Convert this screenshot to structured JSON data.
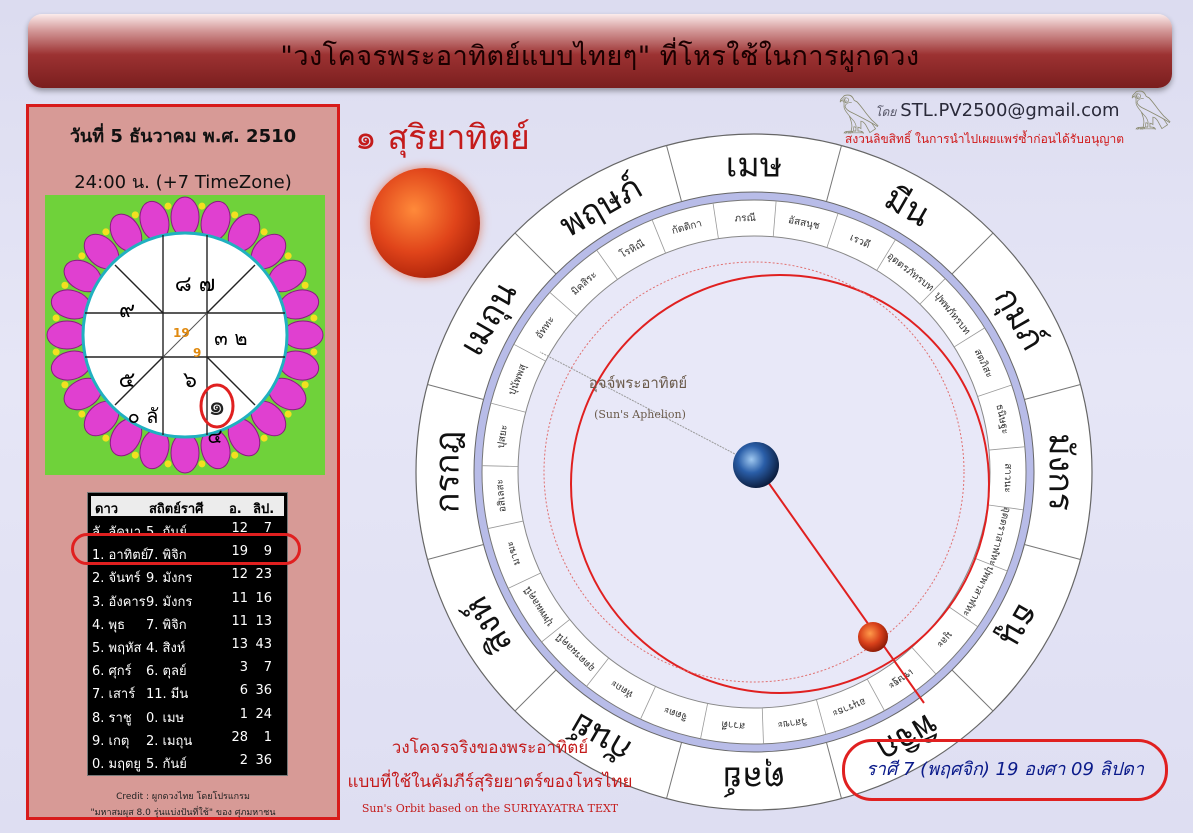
{
  "header": {
    "title": "\"วงโคจรพระอาทิตย์แบบไทยๆ\"  ที่โหรใช้ในการผูกดวง"
  },
  "author": {
    "prefix": "โดย",
    "email": "STL.PV2500@gmail.com",
    "copyright": "สงวนลิขสิทธิ์ ในการนำไปเผยแพร่ซ้ำก่อนได้รับอนุญาต"
  },
  "left_panel": {
    "date": "วันที่ 5 ธันวาคม พ.ศ. 2510",
    "time": "24:00 น. (+7 TimeZone)",
    "horoscope": {
      "cells": [
        "๘ ๗",
        "๙",
        "๓",
        "๒",
        "๕",
        "๖",
        "๑",
        "๐ ลั",
        "๔"
      ],
      "center_fraction": {
        "numerator": "19",
        "denominator": "9"
      }
    },
    "table": {
      "headers": [
        "ดาว",
        "สถิตย์ราศี",
        "อ.",
        "ลิป."
      ],
      "rows": [
        [
          "ลั. ลัคนา",
          "5. กันย์",
          "12",
          "7"
        ],
        [
          "1. อาทิตย์",
          "7. พิจิก",
          "19",
          "9"
        ],
        [
          "2. จันทร์",
          "9. มังกร",
          "12",
          "23"
        ],
        [
          "3. อังคาร",
          "9. มังกร",
          "11",
          "16"
        ],
        [
          "4. พุธ",
          "7. พิจิก",
          "11",
          "13"
        ],
        [
          "5. พฤหัส",
          "4. สิงห์",
          "13",
          "43"
        ],
        [
          "6. ศุกร์",
          "6. ตุลย์",
          "3",
          "7"
        ],
        [
          "7. เสาร์",
          "11. มีน",
          "6",
          "36"
        ],
        [
          "8. ราชู",
          "0. เมษ",
          "1",
          "24"
        ],
        [
          "9. เกตุ",
          "2. เมถุน",
          "28",
          "1"
        ],
        [
          "0. มฤตยู",
          "5. กันย์",
          "2",
          "36"
        ]
      ],
      "highlighted_row": 1
    },
    "credit_1": "Credit : ผูกดวงไทย โดยโปรแกรม",
    "credit_2": "\"มหาสมผุส 8.0 รุ่นแบ่งปันที่ใช้\" ของ ศุภมหาชน"
  },
  "sun": {
    "heading": "๑ สุริยาทิตย์"
  },
  "wheel": {
    "zodiac": [
      "เมษ",
      "พฤษภ์",
      "เมถุน",
      "กรกฎ",
      "สิงห์",
      "กันย์",
      "ตุลย์",
      "พิจิก",
      "ธนู",
      "มังกร",
      "กุมภ์",
      "มีน"
    ],
    "nakshatra": [
      "อัสสนุช",
      "ภรณี",
      "กัตติกา",
      "โรหิณี",
      "มิคสิระ",
      "อัททะ",
      "ปุนัพพสุ",
      "ปุสยะ",
      "อสิเลสะ",
      "มาฆะ",
      "ปุพพผลคุนี",
      "อุตตรผลคุนี",
      "หัตถะ",
      "จิตตะ",
      "สวาตี",
      "วิสาขะ",
      "อนุราธะ",
      "เชษฐะ",
      "มูละ",
      "ปุพพาสาฬหะ",
      "อุตตราสาฬหะ",
      "สาวนะ",
      "ธนิษฐะ",
      "สตภิสะ",
      "ปุพพภัทรบท",
      "อุตตรภัทรบท",
      "เรวดี"
    ],
    "aphelion_label": "อุจจ์พระอาทิตย์",
    "aphelion_label_en": "(Sun's Aphelion)"
  },
  "orbit_caption": {
    "line1": "วงโคจรจริงของพระอาทิตย์",
    "line2": "แบบที่ใช้ในคัมภีร์สุริยยาตร์ของโหรไทย",
    "line3": "Sun's Orbit based on the SURIYAYATRA TEXT"
  },
  "result": {
    "text": "ราศี 7 (พฤศจิก) 19 องศา 09 ลิปดา"
  },
  "colors": {
    "accent": "#c41b1b",
    "orbit": "#e02020",
    "banner": "#8a2a2a",
    "ring": "#b8bce8"
  }
}
